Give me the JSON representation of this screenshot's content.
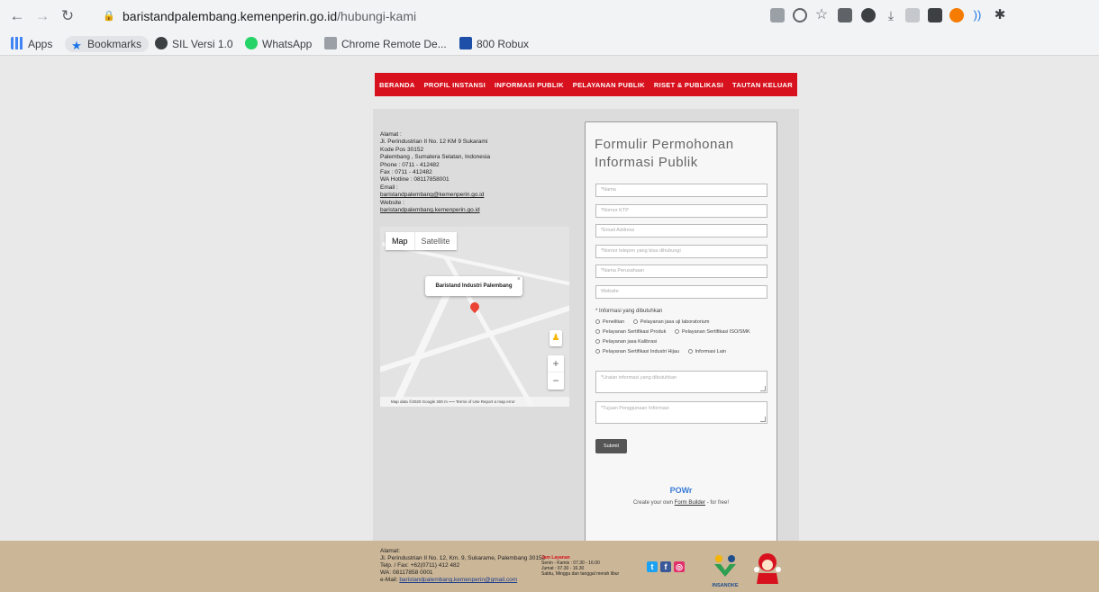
{
  "browser": {
    "url_host": "baristandpalembang.kemenperin.go.id",
    "url_path": "/hubungi-kami",
    "bookmarks": [
      {
        "label": "Apps"
      },
      {
        "label": "Bookmarks"
      },
      {
        "label": "SIL Versi 1.0"
      },
      {
        "label": "WhatsApp"
      },
      {
        "label": "Chrome Remote De..."
      },
      {
        "label": "800 Robux"
      }
    ]
  },
  "nav": {
    "items": [
      "BERANDA",
      "PROFIL INSTANSI",
      "INFORMASI PUBLIK",
      "PELAYANAN PUBLIK",
      "RISET & PUBLIKASI",
      "TAUTAN KELUAR"
    ]
  },
  "contact": {
    "lines": [
      "Alamat :",
      "Jl. Perindustrian II No. 12 KM 9 Sukarami",
      "Kode Pos 30152",
      "Palembang , Sumatera Selatan, Indonesia",
      "Phone : 0711 - 412482",
      "Fax : 0711 - 412482",
      "WA Hotline : 08117858001",
      "Email :"
    ],
    "email": "baristandpalembang@kemenperin.go.id",
    "website_label": "Website :",
    "website": "baristandpalembang.kemenperin.go.id"
  },
  "map": {
    "type_map": "Map",
    "type_satellite": "Satellite",
    "place_label": "Baristand Industri Palembang",
    "zoom_in": "+",
    "zoom_out": "−",
    "footer": "Map data ©2020 Google   300 m ⎯⎯⎯   Terms of Use   Report a map error"
  },
  "form": {
    "title": "Formulir Permohonan Informasi Publik",
    "fields": [
      "*Nama",
      "*Nomor KTP",
      "*Email Address",
      "*Nomor telepon yang bisa dihubungi",
      "*Nama Perusahaan",
      "Website"
    ],
    "radio_question": "* Informasi yang dibutuhkan",
    "radio_options": [
      [
        "Penelitian",
        "Pelayanan jasa uji laboratorium"
      ],
      [
        "Pelayanan Sertifikasi Produk",
        "Pelayanan Sertifikasi ISO/SMK"
      ],
      [
        "Pelayanan jasa Kalibrasi"
      ],
      [
        "Pelayanan Sertifikasi Industri Hijau",
        "Informasi Lain"
      ]
    ],
    "textareas": [
      "*Uraian informasi yang dibutuhkan",
      "*Tujuan Penggunaan Informasi"
    ],
    "submit": "Submit",
    "powr_logo": "POWr",
    "powr_prefix": "Create your own",
    "powr_link": "Form Builder",
    "powr_suffix": "- for free!"
  },
  "footer": {
    "address_lines": [
      "Alamat:",
      "Jl. Perindustrian II No. 12, Km. 9, Sukarame, Palembang 30152",
      "Telp. / Fax: +62(0711) 412 482",
      "WA: 08117858 0001"
    ],
    "email_prefix": "e-Mail: ",
    "email": "baristandpalembang.kemenperin@gmail.com",
    "hours_title": "Jam Layanan",
    "hours_lines": [
      "Senin - Kamis : 07.30 - 16.00",
      "Jumat        : 07.30 - 16.30",
      "Sabtu, Minggu dan tanggal merah libur"
    ],
    "logo_text": "INSANOKE"
  },
  "colors": {
    "nav_red": "#d7121e",
    "footer_bg": "#cbb697",
    "content_bg": "#dcdcdc"
  }
}
